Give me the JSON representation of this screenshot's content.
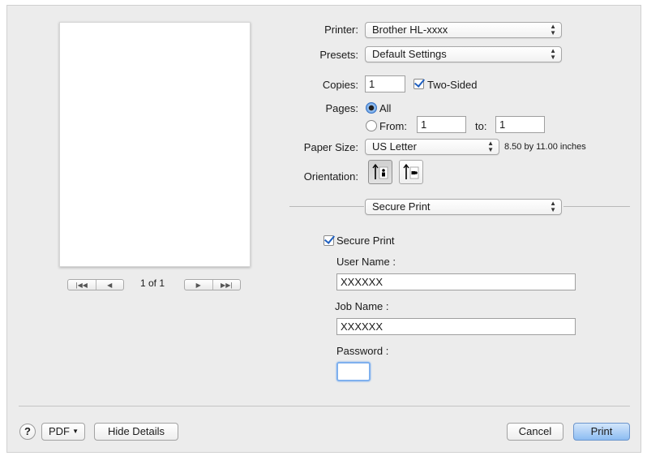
{
  "preview": {
    "page_indicator": "1 of 1"
  },
  "printer": {
    "label": "Printer:",
    "value": "Brother HL-xxxx"
  },
  "presets": {
    "label": "Presets:",
    "value": "Default Settings"
  },
  "copies": {
    "label": "Copies:",
    "value": "1",
    "two_sided_label": "Two-Sided",
    "two_sided_checked": true
  },
  "pages": {
    "label": "Pages:",
    "all_label": "All",
    "from_label": "From:",
    "from_value": "1",
    "to_label": "to:",
    "to_value": "1",
    "selected": "All"
  },
  "paper_size": {
    "label": "Paper Size:",
    "value": "US Letter",
    "dimensions": "8.50 by 11.00 inches"
  },
  "orientation": {
    "label": "Orientation:",
    "selected": "portrait"
  },
  "panel_select": {
    "value": "Secure Print"
  },
  "secure_print": {
    "checkbox_label": "Secure Print",
    "checked": true,
    "user_name_label": "User Name :",
    "user_name_value": "XXXXXX",
    "job_name_label": "Job Name :",
    "job_name_value": "XXXXXX",
    "password_label": "Password :",
    "password_value": ""
  },
  "footer": {
    "help_glyph": "?",
    "pdf_label": "PDF",
    "hide_details_label": "Hide Details",
    "cancel_label": "Cancel",
    "print_label": "Print"
  },
  "colors": {
    "accent": "#8cbcf2",
    "focus_ring": "#7fb0ee",
    "check": "#1f5fbf"
  }
}
